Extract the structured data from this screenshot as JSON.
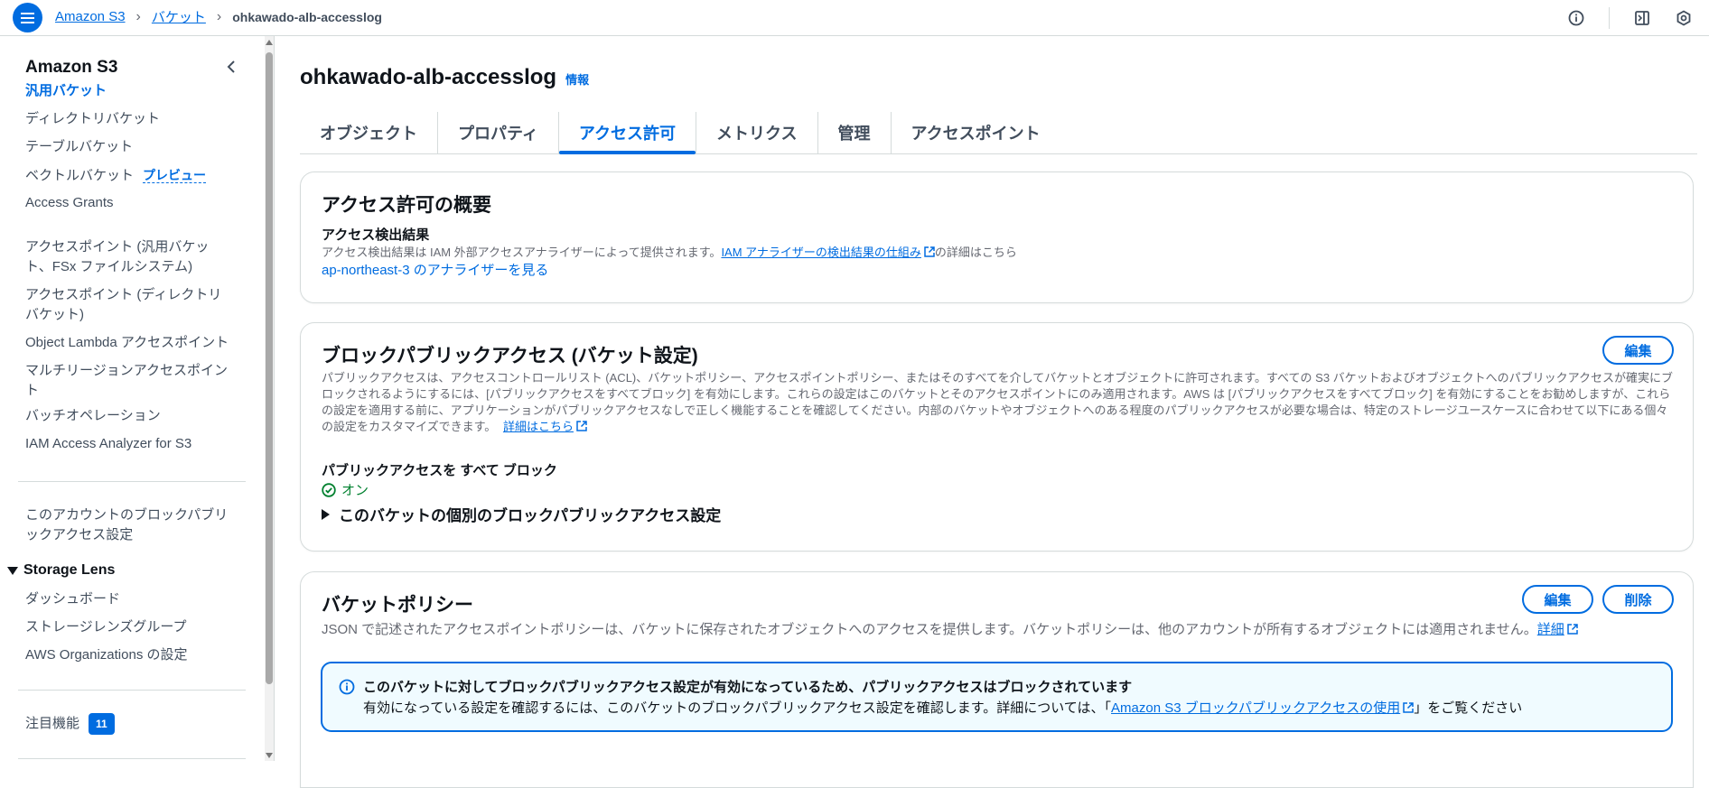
{
  "topbar": {
    "breadcrumbs": [
      "Amazon S3",
      "バケット",
      "ohkawado-alb-accesslog"
    ]
  },
  "sidebar": {
    "title": "Amazon S3",
    "items": [
      {
        "label": "汎用バケット",
        "active": true
      },
      {
        "label": "ディレクトリバケット"
      },
      {
        "label": "テーブルバケット"
      },
      {
        "label": "ベクトルバケット",
        "tag": "プレビュー"
      },
      {
        "label": "Access Grants"
      },
      {
        "label": "アクセスポイント (汎用バケット、FSx ファイルシステム)"
      },
      {
        "label": "アクセスポイント (ディレクトリバケット)"
      },
      {
        "label": "Object Lambda アクセスポイント"
      },
      {
        "label": "マルチリージョンアクセスポイント"
      },
      {
        "label": "バッチオペレーション"
      },
      {
        "label": "IAM Access Analyzer for S3"
      }
    ],
    "account_block": "このアカウントのブロックパブリックアクセス設定",
    "storage_lens": {
      "title": "Storage Lens",
      "items": [
        "ダッシュボード",
        "ストレージレンズグループ",
        "AWS Organizations の設定"
      ]
    },
    "featured": {
      "label": "注目機能",
      "count": "11"
    }
  },
  "main": {
    "title": "ohkawado-alb-accesslog",
    "info": "情報",
    "tabs": [
      {
        "label": "オブジェクト"
      },
      {
        "label": "プロパティ"
      },
      {
        "label": "アクセス許可",
        "active": true
      },
      {
        "label": "メトリクス"
      },
      {
        "label": "管理"
      },
      {
        "label": "アクセスポイント"
      }
    ],
    "overview": {
      "title": "アクセス許可の概要",
      "findings_label": "アクセス検出結果",
      "findings_desc": "アクセス検出結果は IAM 外部アクセスアナライザーによって提供されます。",
      "findings_link": "IAM アナライザーの検出結果の仕組み",
      "findings_suffix": "の詳細はこちら",
      "analyzer_link": "ap-northeast-3 のアナライザーを見る"
    },
    "bpa": {
      "title": "ブロックパブリックアクセス (バケット設定)",
      "edit": "編集",
      "desc": "パブリックアクセスは、アクセスコントロールリスト (ACL)、バケットポリシー、アクセスポイントポリシー、またはそのすべてを介してバケットとオブジェクトに許可されます。すべての S3 バケットおよびオブジェクトへのパブリックアクセスが確実にブロックされるようにするには、[パブリックアクセスをすべてブロック] を有効にします。これらの設定はこのバケットとそのアクセスポイントにのみ適用されます。AWS は [パブリックアクセスをすべてブロック] を有効にすることをお勧めしますが、これらの設定を適用する前に、アプリケーションがパブリックアクセスなしで正しく機能することを確認してください。内部のバケットやオブジェクトへのある程度のパブリックアクセスが必要な場合は、特定のストレージユースケースに合わせて以下にある個々の設定をカスタマイズできます。",
      "learn_more": "詳細はこちら",
      "block_all_label": "パブリックアクセスを すべて ブロック",
      "status": "オン",
      "expander": "このバケットの個別のブロックパブリックアクセス設定"
    },
    "policy": {
      "title": "バケットポリシー",
      "edit": "編集",
      "delete": "削除",
      "desc": "JSON で記述されたアクセスポイントポリシーは、バケットに保存されたオブジェクトへのアクセスを提供します。バケットポリシーは、他のアカウントが所有するオブジェクトには適用されません。",
      "detail_link": "詳細",
      "alert_title": "このバケットに対してブロックパブリックアクセス設定が有効になっているため、パブリックアクセスはブロックされています",
      "alert_body_prefix": "有効になっている設定を確認するには、このバケットのブロックパブリックアクセス設定を確認します。詳細については、「",
      "alert_link": "Amazon S3 ブロックパブリックアクセスの使用",
      "alert_body_suffix": "」をご覧ください"
    }
  },
  "colors": {
    "accent": "#006ce0",
    "success": "#00802f",
    "info_bg": "#f0fbff"
  }
}
